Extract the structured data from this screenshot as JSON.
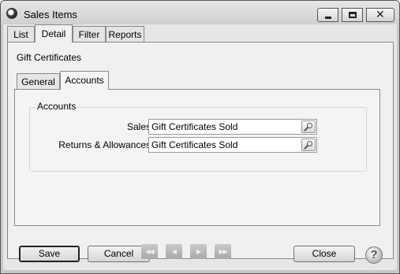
{
  "window": {
    "title": "Sales Items",
    "icon": "app-logo-icon",
    "controls": {
      "minimize": "minimize-icon",
      "maximize": "maximize-icon",
      "close": "close-icon",
      "close_glyph": "✕"
    }
  },
  "top_tabs": [
    {
      "label": "List",
      "active": false
    },
    {
      "label": "Detail",
      "active": true
    },
    {
      "label": "Filter",
      "active": false
    },
    {
      "label": "Reports",
      "active": false
    }
  ],
  "record": {
    "title": "Gift Certificates"
  },
  "sub_tabs": [
    {
      "label": "General",
      "active": false
    },
    {
      "label": "Accounts",
      "active": true
    }
  ],
  "accounts_group": {
    "title": "Accounts",
    "rows": [
      {
        "label": "Sales",
        "value": "Gift Certificates Sold",
        "lookup_icon": "search-icon"
      },
      {
        "label": "Returns & Allowances",
        "value": "Gift Certificates Sold",
        "lookup_icon": "search-icon"
      }
    ]
  },
  "buttons": {
    "save": "Save",
    "cancel": "Cancel",
    "close": "Close"
  },
  "navigation": {
    "first": "◀◀",
    "previous": "◀",
    "next": "▶",
    "last": "▶▶",
    "enabled": false
  },
  "help": {
    "glyph": "?",
    "icon": "help-icon"
  },
  "colors": {
    "window_bg": "#e6e6e6",
    "panel_bg": "#f0f0f0",
    "border": "#8a8a8a",
    "disabled_nav": "#b5b5b5"
  }
}
